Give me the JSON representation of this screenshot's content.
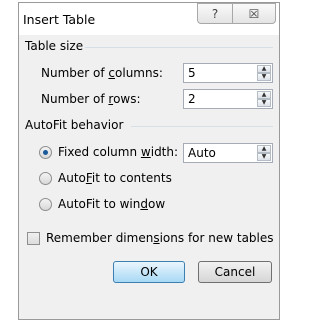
{
  "dialog": {
    "title": "Insert Table",
    "help_glyph": "?",
    "close_glyph": "☒"
  },
  "table_size": {
    "label": "Table size",
    "columns": {
      "label_pre": "Number of ",
      "label_key": "c",
      "label_post": "olumns:",
      "value": "5"
    },
    "rows": {
      "label_pre": "Number of ",
      "label_key": "r",
      "label_post": "ows:",
      "value": "2"
    }
  },
  "autofit": {
    "label": "AutoFit behavior",
    "fixed": {
      "label_pre": "Fixed column ",
      "label_key": "w",
      "label_post": "idth:",
      "value": "Auto",
      "selected": true
    },
    "contents": {
      "label_pre": "Auto",
      "label_key": "F",
      "label_post": "it to contents",
      "selected": false
    },
    "window": {
      "label_pre": "AutoFit to win",
      "label_key": "d",
      "label_post": "ow",
      "selected": false
    }
  },
  "remember": {
    "label_pre": "Remember dimen",
    "label_key": "s",
    "label_post": "ions for new tables",
    "checked": false
  },
  "buttons": {
    "ok": "OK",
    "cancel": "Cancel"
  },
  "spin_up_glyph": "▲",
  "spin_down_glyph": "▼"
}
